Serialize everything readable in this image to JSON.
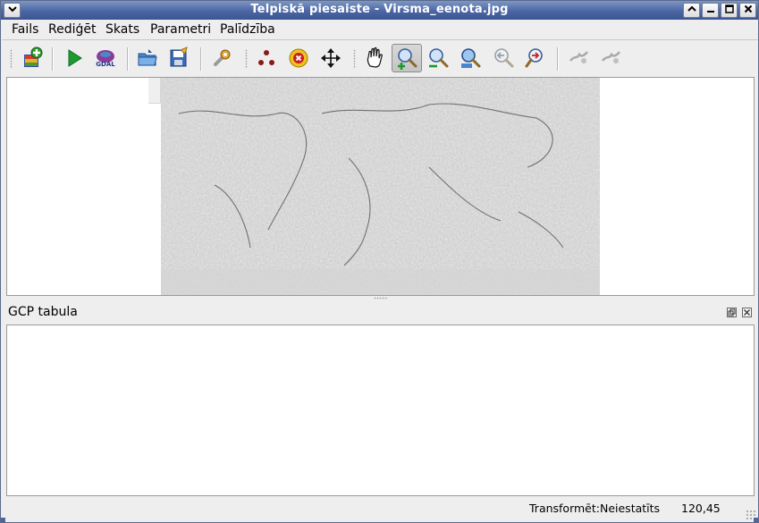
{
  "window": {
    "title": "Telpiskā piesaiste - Virsma_eenota.jpg"
  },
  "menubar": {
    "items": [
      {
        "label": "Fails"
      },
      {
        "label": "Rediģēt"
      },
      {
        "label": "Skats"
      },
      {
        "label": "Parametri"
      },
      {
        "label": "Palīdzība"
      }
    ]
  },
  "toolbar": {
    "tools": [
      {
        "icon": "open-raster-icon"
      },
      {
        "icon": "start-georeferencing-icon"
      },
      {
        "icon": "generate-gdal-script-icon"
      },
      {
        "icon": "load-gcp-points-icon"
      },
      {
        "icon": "save-gcp-points-icon"
      },
      {
        "icon": "transformation-settings-icon"
      },
      {
        "icon": "add-point-icon"
      },
      {
        "icon": "delete-point-icon"
      },
      {
        "icon": "move-gcp-point-icon"
      },
      {
        "icon": "pan-icon"
      },
      {
        "icon": "zoom-in-icon",
        "active": true
      },
      {
        "icon": "zoom-out-icon"
      },
      {
        "icon": "zoom-to-layer-icon"
      },
      {
        "icon": "zoom-last-icon"
      },
      {
        "icon": "zoom-next-icon"
      },
      {
        "icon": "link-georeferencer-icon"
      },
      {
        "icon": "link-qgis-icon"
      }
    ]
  },
  "dock": {
    "title": "GCP tabula"
  },
  "statusbar": {
    "transform": "Transformēt:Neiestatīts",
    "coords": "120,45"
  },
  "colors": {
    "titlebar": "#4b66a4",
    "window_bg": "#eeeeee"
  }
}
